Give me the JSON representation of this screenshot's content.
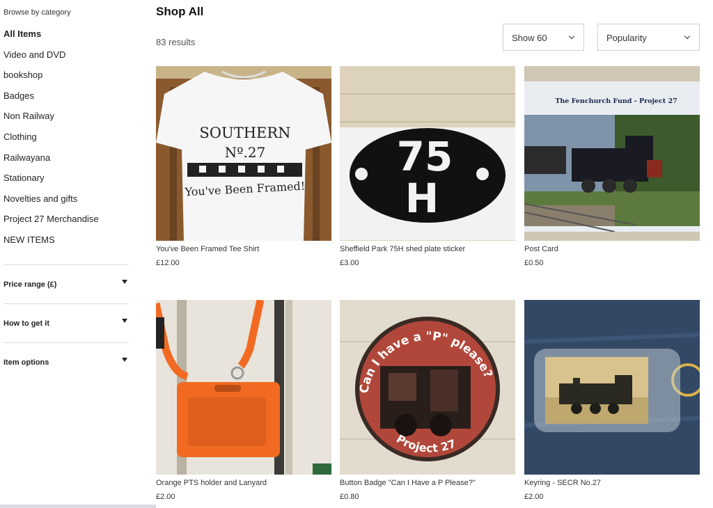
{
  "sidebar": {
    "browse_label": "Browse by category",
    "categories": [
      {
        "label": "All Items"
      },
      {
        "label": "Video and DVD"
      },
      {
        "label": "bookshop"
      },
      {
        "label": "Badges"
      },
      {
        "label": "Non Railway"
      },
      {
        "label": "Clothing"
      },
      {
        "label": "Railwayana"
      },
      {
        "label": "Stationary"
      },
      {
        "label": "Novelties and gifts"
      },
      {
        "label": "Project 27 Merchandise"
      },
      {
        "label": "NEW ITEMS"
      }
    ],
    "filters": [
      {
        "label": "Price range (£)",
        "icon": "caret-down-icon"
      },
      {
        "label": "How to get it",
        "icon": "caret-down-icon"
      },
      {
        "label": "Item options",
        "icon": "caret-down-icon"
      }
    ]
  },
  "main": {
    "title": "Shop All",
    "results": "83 results",
    "show_select": {
      "value": "Show 60"
    },
    "sort_select": {
      "value": "Popularity"
    },
    "products": [
      {
        "name": "You've Been Framed Tee Shirt",
        "price": "£12.00",
        "image": {
          "line1": "SOUTHERN",
          "line2": "Nº.27",
          "line3": "You've Been Framed!"
        }
      },
      {
        "name": "Sheffield Park 75H shed plate sticker",
        "price": "£3.00",
        "image": {
          "line1": "75",
          "line2": "H"
        }
      },
      {
        "name": "Post Card",
        "price": "£0.50",
        "image": {
          "caption": "The Fenchurch Fund - Project 27"
        }
      },
      {
        "name": "Orange PTS holder and Lanyard",
        "price": "£2.00"
      },
      {
        "name": "Button Badge \"Can I Have a P Please?\"",
        "price": "£0.80",
        "image": {
          "top_text": "Can I have a \"P\" please?",
          "bottom_text": "Project 27"
        }
      },
      {
        "name": "Keyring - SECR No.27",
        "price": "£2.00"
      }
    ]
  },
  "colors": {
    "accent_orange": "#f26a21",
    "badge_red": "#b1473a",
    "dark": "#222222"
  }
}
